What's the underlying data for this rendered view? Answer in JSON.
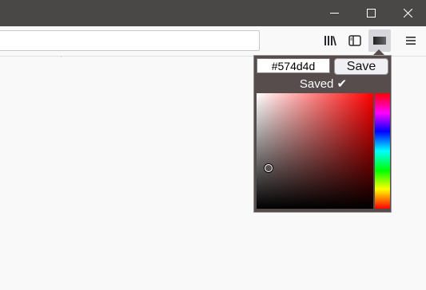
{
  "window": {
    "controls": [
      "minimize",
      "maximize",
      "close"
    ]
  },
  "toolbar": {
    "url_value": "",
    "icons": [
      "library-icon",
      "sidebar-icon",
      "extension-icon",
      "menu-icon"
    ]
  },
  "picker": {
    "hex_value": "#574d4d",
    "save_label": "Save",
    "status_text": "Saved ✔",
    "background_color": "#574d4d",
    "hue_color": "#ff0000",
    "cursor_saturation": 0.1,
    "cursor_value": 0.35
  }
}
